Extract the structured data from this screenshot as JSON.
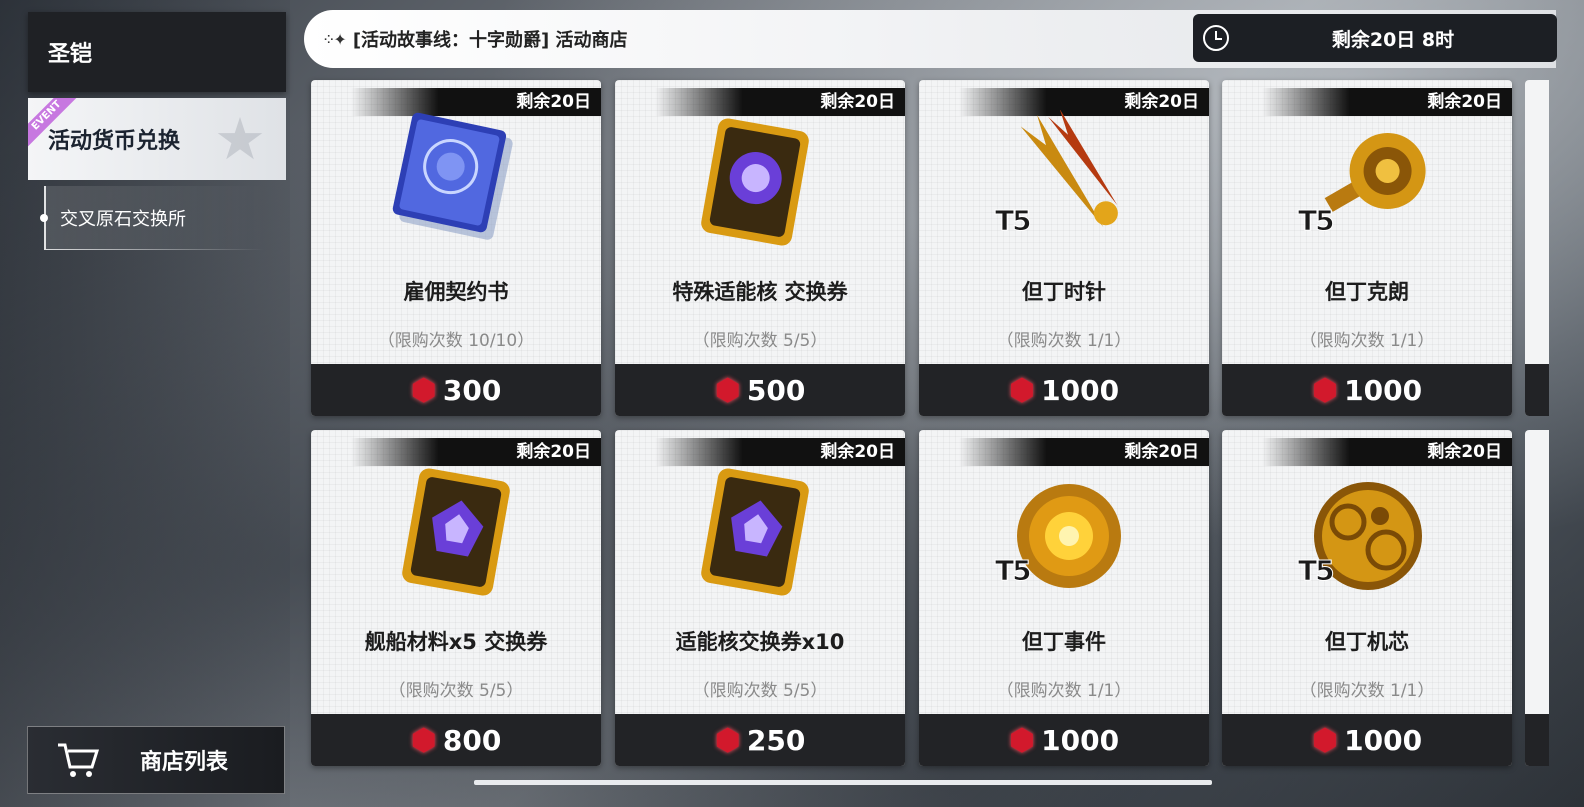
{
  "sidebar": {
    "category_title": "圣铠",
    "active_category": "活动货币兑换",
    "event_tag": "EVENT",
    "sub_item": "交叉原石交换所",
    "shop_list_label": "商店列表"
  },
  "header": {
    "title": "[活动故事线：十字勋爵] 活动商店",
    "timer": "剩余20日 8时"
  },
  "items": [
    {
      "remain": "剩余20日",
      "name": "雇佣契约书",
      "limit": "（限购次数 10/10）",
      "price": "300",
      "tier": ""
    },
    {
      "remain": "剩余20日",
      "name": "特殊适能核 交换券",
      "limit": "（限购次数 5/5）",
      "price": "500",
      "tier": ""
    },
    {
      "remain": "剩余20日",
      "name": "但丁时针",
      "limit": "（限购次数 1/1）",
      "price": "1000",
      "tier": "T5"
    },
    {
      "remain": "剩余20日",
      "name": "但丁克朗",
      "limit": "（限购次数 1/1）",
      "price": "1000",
      "tier": "T5"
    },
    {
      "remain": "剩余20日",
      "name": "舰船材料x5 交换券",
      "limit": "（限购次数 5/5）",
      "price": "800",
      "tier": ""
    },
    {
      "remain": "剩余20日",
      "name": "适能核交换券x10",
      "limit": "（限购次数 5/5）",
      "price": "250",
      "tier": ""
    },
    {
      "remain": "剩余20日",
      "name": "但丁事件",
      "limit": "（限购次数 1/1）",
      "price": "1000",
      "tier": "T5"
    },
    {
      "remain": "剩余20日",
      "name": "但丁机芯",
      "limit": "（限购次数 1/1）",
      "price": "1000",
      "tier": "T5"
    }
  ],
  "colors": {
    "currency_gem": "#d2192c",
    "price_bar": "#222326",
    "header_bg": "#ffffff"
  }
}
